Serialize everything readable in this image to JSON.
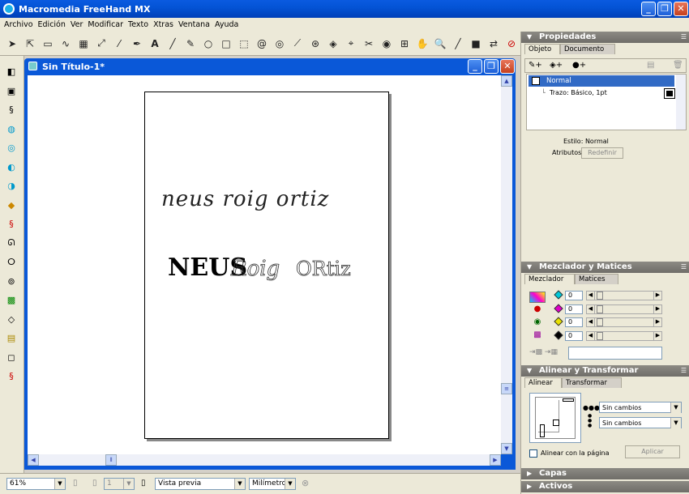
{
  "app": {
    "title": "Macromedia FreeHand MX"
  },
  "menu": [
    "Archivo",
    "Edición",
    "Ver",
    "Modificar",
    "Texto",
    "Xtras",
    "Ventana",
    "Ayuda"
  ],
  "document": {
    "title": "Sin Título-1*"
  },
  "artwork": {
    "line1": "neus roig ortiz",
    "line2_a": "NEUS",
    "line2_b": "Roig",
    "line2_c": "ORtiz"
  },
  "status": {
    "zoom": "61%",
    "page_number": "1",
    "view_mode": "Vista previa",
    "units": "Milímetros"
  },
  "properties": {
    "title": "Propiedades",
    "tabs": [
      "Objeto",
      "Documento"
    ],
    "item_selected": "Normal",
    "item_child": "Trazo: Básico, 1pt",
    "style_label": "Estilo: Normal",
    "attributes_label": "Atributos:",
    "redefine_button": "Redefinir"
  },
  "mixer": {
    "title": "Mezclador y Matices",
    "tabs": [
      "Mezclador",
      "Matices"
    ],
    "channels": [
      {
        "color": "#00c8d8",
        "value": "0"
      },
      {
        "color": "#e000c8",
        "value": "0"
      },
      {
        "color": "#e8e000",
        "value": "0"
      },
      {
        "color": "#000000",
        "value": "0"
      }
    ]
  },
  "align": {
    "title": "Alinear y Transformar",
    "tabs": [
      "Alinear",
      "Transformar"
    ],
    "horizontal": "Sin cambios",
    "vertical": "Sin cambios",
    "align_to_page": "Alinear con la página",
    "apply_button": "Aplicar"
  },
  "collapsed_panels": [
    "Capas",
    "Activos"
  ]
}
